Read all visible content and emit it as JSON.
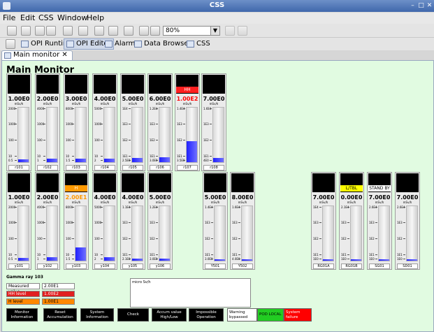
{
  "window": {
    "title": "CSS"
  },
  "menu": [
    "File",
    "Edit",
    "CSS",
    "Window",
    "Help"
  ],
  "toolbar": {
    "zoom": "80%"
  },
  "perspectives": [
    {
      "label": "OPI Runtime"
    },
    {
      "label": "OPI Editor",
      "active": true
    },
    {
      "label": "Alarm"
    },
    {
      "label": "Data Browser"
    },
    {
      "label": "CSS"
    }
  ],
  "tab": {
    "label": "Main monitor ✕"
  },
  "page": {
    "title": "Main Monitor"
  },
  "monitors_row1": [
    {
      "name": "r101",
      "value": "1.00E0",
      "unit": "mSv/h",
      "ticks": [
        "2000",
        "1000",
        "100",
        "10",
        "0.5"
      ],
      "level": 0.05
    },
    {
      "name": "r102",
      "value": "2.00E0",
      "unit": "mSv/h",
      "ticks": [
        "4000",
        "1000",
        "100",
        "10",
        "1"
      ],
      "level": 0.07
    },
    {
      "name": "r103",
      "value": "3.00E0",
      "unit": "mSv/h",
      "ticks": [
        "8000",
        "1000",
        "100",
        "10",
        "1.5"
      ],
      "level": 0.06
    },
    {
      "name": "r104",
      "value": "4.00E0",
      "unit": "mSv/h",
      "ticks": [
        "5000",
        "1000",
        "100",
        "10",
        "2"
      ],
      "level": 0.07
    },
    {
      "name": "r105",
      "value": "5.00E0",
      "unit": "mSv/h",
      "ticks": [
        "1E4",
        "1E3",
        "1E2",
        "1E1",
        "2.5E0"
      ],
      "level": 0.08
    },
    {
      "name": "r106",
      "value": "6.00E0",
      "unit": "mSv/h",
      "ticks": [
        "1.2E4",
        "1E3",
        "1E2",
        "1E1",
        "3.0E0"
      ],
      "level": 0.09
    },
    {
      "name": "r107",
      "value": "1.00E2",
      "unit": "mSv/h",
      "ticks": [
        "1.4E4",
        "1E3",
        "1E2",
        "1E1",
        "3.5E0"
      ],
      "level": 0.38,
      "alarm": "HH",
      "alarm_bg": "#ff2020",
      "alarm_fg": "#ffffff",
      "value_color": "#ff0000"
    },
    {
      "name": "r108",
      "value": "7.00E0",
      "unit": "mSv/h",
      "ticks": [
        "1.6E4",
        "1E3",
        "1E2",
        "1E1",
        "4E0"
      ],
      "level": 0.08
    }
  ],
  "monitors_row2": [
    {
      "name": "y101",
      "value": "1.00E0",
      "unit": "mSv/h",
      "ticks": [
        "2000",
        "1000",
        "100",
        "10",
        "0.5"
      ],
      "level": 0.05
    },
    {
      "name": "y102",
      "value": "2.00E0",
      "unit": "mSv/h",
      "ticks": [
        "4000",
        "1000",
        "100",
        "10",
        "1"
      ],
      "level": 0.06
    },
    {
      "name": "y103",
      "value": "2.00E1",
      "unit": "mSv/h",
      "ticks": [
        "8000",
        "1000",
        "100",
        "10",
        "1.5"
      ],
      "level": 0.25,
      "alarm": "H",
      "alarm_bg": "#ff9900",
      "alarm_fg": "#ffffff",
      "value_color": "#ff9900"
    },
    {
      "name": "y104",
      "value": "4.00E0",
      "unit": "mSv/h",
      "ticks": [
        "5000",
        "1000",
        "100",
        "10",
        "2"
      ],
      "level": 0.07
    },
    {
      "name": "y105",
      "value": "4.00E0",
      "unit": "mSv/h",
      "ticks": [
        "1.1E4",
        "1E3",
        "1E2",
        "1E1",
        "2.1E0"
      ],
      "level": 0.04
    },
    {
      "name": "y106",
      "value": "5.00E0",
      "unit": "mSv/h",
      "ticks": [
        "1.2E4",
        "1E3",
        "1E2",
        "1E1",
        "3.0E0"
      ],
      "level": 0.04
    },
    {
      "name": "Y501",
      "value": "5.00E0",
      "unit": "mSv/h",
      "ticks": [
        "1.4E4",
        "1E3",
        "1E2",
        "1E1",
        "3.0E0"
      ],
      "level": 0.03
    },
    {
      "name": "Y502",
      "value": "8.00E0",
      "unit": "mSv/h",
      "ticks": [
        "1.6E4",
        "1E3",
        "1E2",
        "1E1",
        "4.0E0"
      ],
      "level": 0.03
    },
    {
      "name": "RG01A",
      "value": "7.00E0",
      "unit": "mSv/h",
      "ticks": [
        "1E4",
        "1E3",
        "1E2",
        "1E1",
        "1E0"
      ],
      "level": 0.03
    },
    {
      "name": "RG01B",
      "value": "0.00E0",
      "unit": "mSv/h",
      "ticks": [
        "2.1E4",
        "1E3",
        "1E2",
        "1E1",
        "1E0"
      ],
      "level": 0.02,
      "alarm": "L/TBL",
      "alarm_bg": "#ffff00",
      "alarm_fg": "#000000"
    },
    {
      "name": "SG01",
      "value": "7.00E0",
      "unit": "mSv/h",
      "ticks": [
        "2.6E4",
        "1E3",
        "1E2",
        "1E1",
        "1E0"
      ],
      "level": 0.02,
      "alarm": "STAND BY",
      "alarm_bg": "#ffffff",
      "alarm_fg": "#000000"
    },
    {
      "name": "SD01",
      "value": "7.00E0",
      "unit": "mSv/h",
      "ticks": [
        "2.6E4",
        "1E3",
        "1E2",
        "1E1",
        "1E0"
      ],
      "level": 0.02
    }
  ],
  "gamma": {
    "title": "Gamma ray 103",
    "measured_label": "Measured value",
    "measured_value": "2.00E1",
    "hh_label": "HH level",
    "hh_value": "1.00E2",
    "h_label": "H level",
    "h_value": "1.00E1"
  },
  "chart_label": "micro Sv/h",
  "buttons": [
    {
      "label": "Monitor\nInformation"
    },
    {
      "label": "Reset\nAccumulation"
    },
    {
      "label": "System\nInformation"
    },
    {
      "label": "Check"
    },
    {
      "label": "Accum value\nHigh/Low"
    },
    {
      "label": "Impossible\nOperation"
    }
  ],
  "status": {
    "warning": "Warning\nbypassed",
    "pod_local": "POD LOCAL",
    "system_failure": "System failure"
  },
  "colors": {
    "canvas_bg": "#e1fbe1",
    "fill": "#2020ff",
    "pod_local": "#22cc22",
    "system_failure": "#ff0000"
  }
}
